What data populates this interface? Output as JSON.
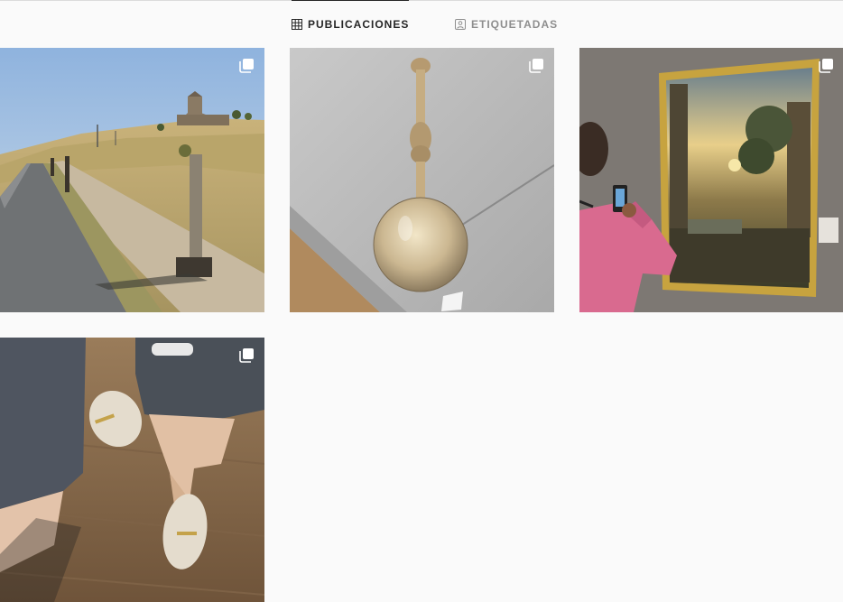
{
  "tabs": [
    {
      "label": "PUBLICACIONES",
      "icon": "grid-icon",
      "active": true
    },
    {
      "label": "ETIQUETADAS",
      "icon": "tagged-user-icon",
      "active": false
    }
  ],
  "posts": [
    {
      "subject": "rural-road-with-church",
      "multi": true,
      "icon": "multiple-images-icon"
    },
    {
      "subject": "pendant-bulb-lamp",
      "multi": true,
      "icon": "multiple-images-icon"
    },
    {
      "subject": "man-photographing-painting",
      "multi": true,
      "icon": "multiple-images-icon"
    },
    {
      "subject": "legs-with-loafers",
      "multi": true,
      "icon": "multiple-images-icon"
    }
  ],
  "colors": {
    "background": "#fafafa",
    "active_tab": "#262626",
    "inactive_tab": "#8e8e8e",
    "divider": "#dbdbdb"
  }
}
